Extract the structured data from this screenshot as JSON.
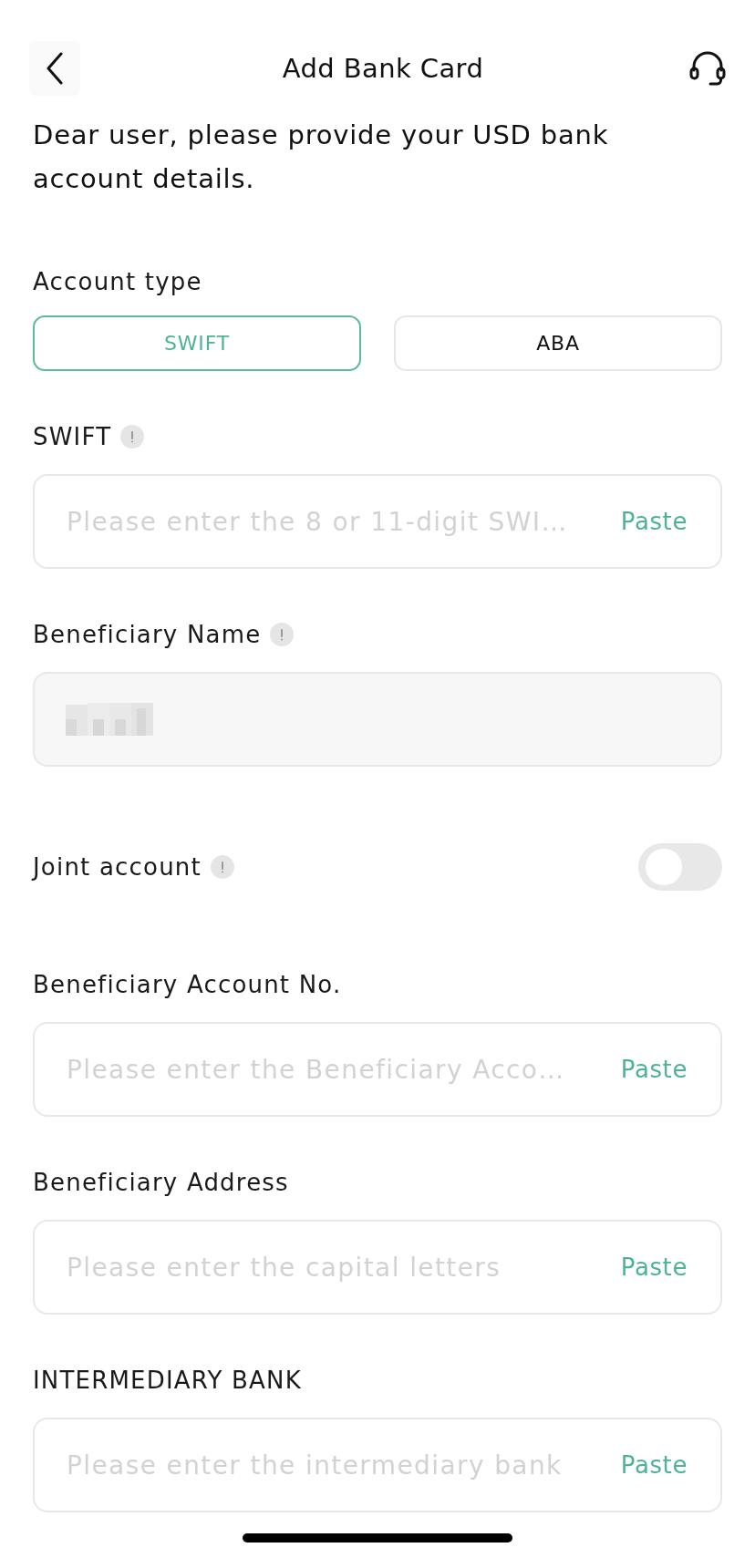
{
  "header": {
    "title": "Add Bank Card"
  },
  "intro": "Dear user, please provide your USD bank account details.",
  "account_type": {
    "label": "Account type",
    "options": [
      {
        "label": "SWIFT",
        "selected": true
      },
      {
        "label": "ABA",
        "selected": false
      }
    ]
  },
  "fields": [
    {
      "kind": "input",
      "label": "SWIFT",
      "info": true,
      "placeholder": "Please enter the 8 or 11-digit SWI…",
      "action": "Paste"
    },
    {
      "kind": "readonly",
      "label": "Beneficiary Name",
      "info": true,
      "value_blurred": true
    },
    {
      "kind": "toggle",
      "label": "Joint account",
      "info": true,
      "on": false
    },
    {
      "kind": "input",
      "label": "Beneficiary Account No.",
      "info": false,
      "placeholder": "Please enter the Beneficiary Acco…",
      "action": "Paste"
    },
    {
      "kind": "input",
      "label": "Beneficiary Address",
      "info": false,
      "placeholder": "Please enter the capital letters",
      "action": "Paste"
    },
    {
      "kind": "input",
      "label": "INTERMEDIARY BANK",
      "info": false,
      "placeholder": "Please enter the intermediary bank",
      "action": "Paste"
    }
  ]
}
